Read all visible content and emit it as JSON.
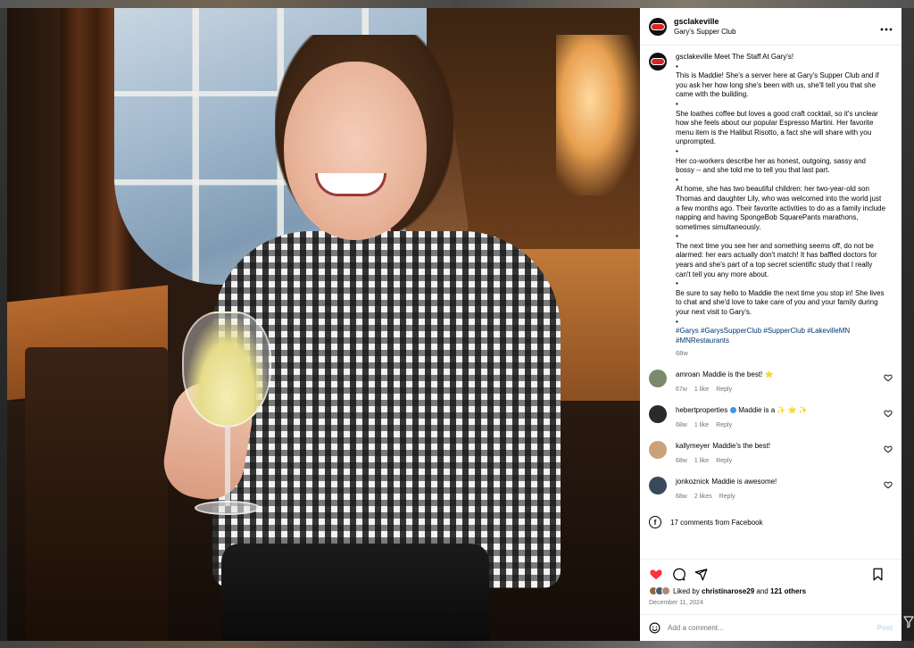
{
  "post": {
    "username": "gsclakeville",
    "location": "Gary's Supper Club",
    "caption_user": "gsclakeville",
    "caption_lines": [
      "Meet The Staff At Gary's!",
      "•",
      "This is Maddie! She's a server here at Gary's Supper Club and if you ask her how long she's been with us, she'll tell you that she came with the building.",
      "•",
      "She loathes coffee but loves a good craft cocktail, so it's unclear how she feels about our popular Espresso Martini. Her favorite menu item is the Halibut Risotto, a fact she will share with you unprompted.",
      "•",
      "Her co-workers describe her as honest, outgoing, sassy and bossy -- and she told me to tell you that last part.",
      "•",
      "At home, she has two beautiful children: her two-year-old son Thomas and daughter Lily, who was welcomed into the world just a few months ago. Their favorite activities to do as a family include napping and having SpongeBob SquarePants marathons, sometimes simultaneously.",
      "•",
      "The next time you see her and something seems off, do not be alarmed: her ears actually don't match! It has baffled doctors for years and she's part of a top secret scientific study that I really can't tell you any more about.",
      "•",
      "Be sure to say hello to Maddie the next time you stop in! She lives to chat and she'd love to take care of you and your family during your next visit to Gary's.",
      "•"
    ],
    "hashtags": "#Garys #GarysSupperClub #SupperClub #LakevilleMN #MNRestaurants",
    "caption_age": "68w"
  },
  "comments": [
    {
      "user": "amroan",
      "text": "Maddie is the best! ⭐",
      "age": "67w",
      "likes": "1 like",
      "reply": "Reply",
      "verified": false,
      "avatar_color": "#7a8a6a"
    },
    {
      "user": "hebertproperties",
      "text": "Maddie is a ✨ ⭐ ✨",
      "age": "68w",
      "likes": "1 like",
      "reply": "Reply",
      "verified": true,
      "avatar_color": "#2a2a2a"
    },
    {
      "user": "kallymeyer",
      "text": "Maddie's the best!",
      "age": "68w",
      "likes": "1 like",
      "reply": "Reply",
      "verified": false,
      "avatar_color": "#c9a27a"
    },
    {
      "user": "jonkoznick",
      "text": "Maddie is awesome!",
      "age": "68w",
      "likes": "2 likes",
      "reply": "Reply",
      "verified": false,
      "avatar_color": "#3a4a5a"
    }
  ],
  "facebook_comments": "17 comments from Facebook",
  "likes": {
    "prefix": "Liked by",
    "user": "christinarose29",
    "and": "and",
    "others": "121 others"
  },
  "date": "December 11, 2024",
  "comment_box": {
    "placeholder": "Add a comment...",
    "post_label": "Post"
  },
  "colors": {
    "heart_red": "#ff3040",
    "link_blue": "#00376b",
    "post_disabled": "#b2dffc",
    "muted": "#737373"
  },
  "icons": {
    "more": "more-options-icon",
    "like": "heart-filled-icon",
    "comment": "comment-bubble-icon",
    "share": "send-icon",
    "save": "bookmark-icon",
    "emoji": "emoji-icon",
    "facebook": "facebook-icon"
  }
}
